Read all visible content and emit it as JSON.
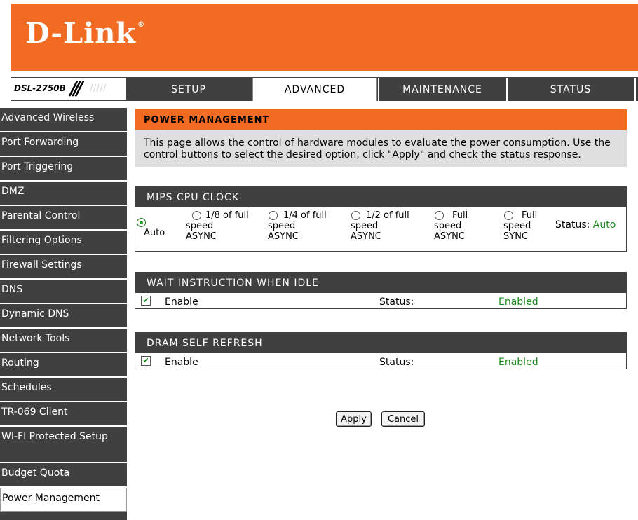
{
  "header": {
    "logo_text": "D-Link",
    "logo_reg": "®"
  },
  "topbar": {
    "model": "DSL-2750B",
    "tabs": [
      {
        "label": "SETUP",
        "active": false
      },
      {
        "label": "ADVANCED",
        "active": true
      },
      {
        "label": "MAINTENANCE",
        "active": false
      },
      {
        "label": "STATUS",
        "active": false
      }
    ]
  },
  "sidebar": {
    "items": [
      {
        "label": "Advanced Wireless"
      },
      {
        "label": "Port Forwarding"
      },
      {
        "label": "Port Triggering"
      },
      {
        "label": "DMZ"
      },
      {
        "label": "Parental Control"
      },
      {
        "label": "Filtering Options"
      },
      {
        "label": "Firewall Settings"
      },
      {
        "label": "DNS"
      },
      {
        "label": "Dynamic DNS"
      },
      {
        "label": "Network Tools"
      },
      {
        "label": "Routing"
      },
      {
        "label": "Schedules"
      },
      {
        "label": "TR-069 Client"
      },
      {
        "label": "WI-FI Protected Setup"
      },
      {
        "label": "Budget Quota"
      },
      {
        "label": "Power Management",
        "active": true
      }
    ]
  },
  "main": {
    "title": "POWER MANAGEMENT",
    "description": "This page allows the control of hardware modules to evaluate the power consumption. Use the control buttons to select the desired option, click \"Apply\" and check the status response.",
    "cpu": {
      "title": "MIPS CPU CLOCK",
      "options": [
        {
          "label": "Auto",
          "checked": true
        },
        {
          "label": "1/8 of full speed ASYNC",
          "line1": "1/8 of full",
          "line2": "speed",
          "line3": "ASYNC",
          "checked": false
        },
        {
          "label": "1/4 of full speed ASYNC",
          "line1": "1/4 of full",
          "line2": "speed",
          "line3": "ASYNC",
          "checked": false
        },
        {
          "label": "1/2 of full speed ASYNC",
          "line1": "1/2 of full",
          "line2": "speed",
          "line3": "ASYNC",
          "checked": false
        },
        {
          "label": "Full speed ASYNC",
          "line1": "Full",
          "line2": "speed",
          "line3": "ASYNC",
          "checked": false
        },
        {
          "label": "Full speed SYNC",
          "line1": "Full",
          "line2": "speed",
          "line3": "SYNC",
          "checked": false
        }
      ],
      "status_label": "Status:",
      "status_value": "Auto"
    },
    "wait": {
      "title": "WAIT INSTRUCTION WHEN IDLE",
      "enable_label": "Enable",
      "checked": true,
      "status_label": "Status:",
      "status_value": "Enabled"
    },
    "dram": {
      "title": "DRAM SELF REFRESH",
      "enable_label": "Enable",
      "checked": true,
      "status_label": "Status:",
      "status_value": "Enabled"
    },
    "buttons": {
      "apply": "Apply",
      "cancel": "Cancel"
    }
  },
  "colors": {
    "brand_orange": "#f26b22",
    "dark_bar": "#404040",
    "status_green": "#1a8a1a"
  }
}
